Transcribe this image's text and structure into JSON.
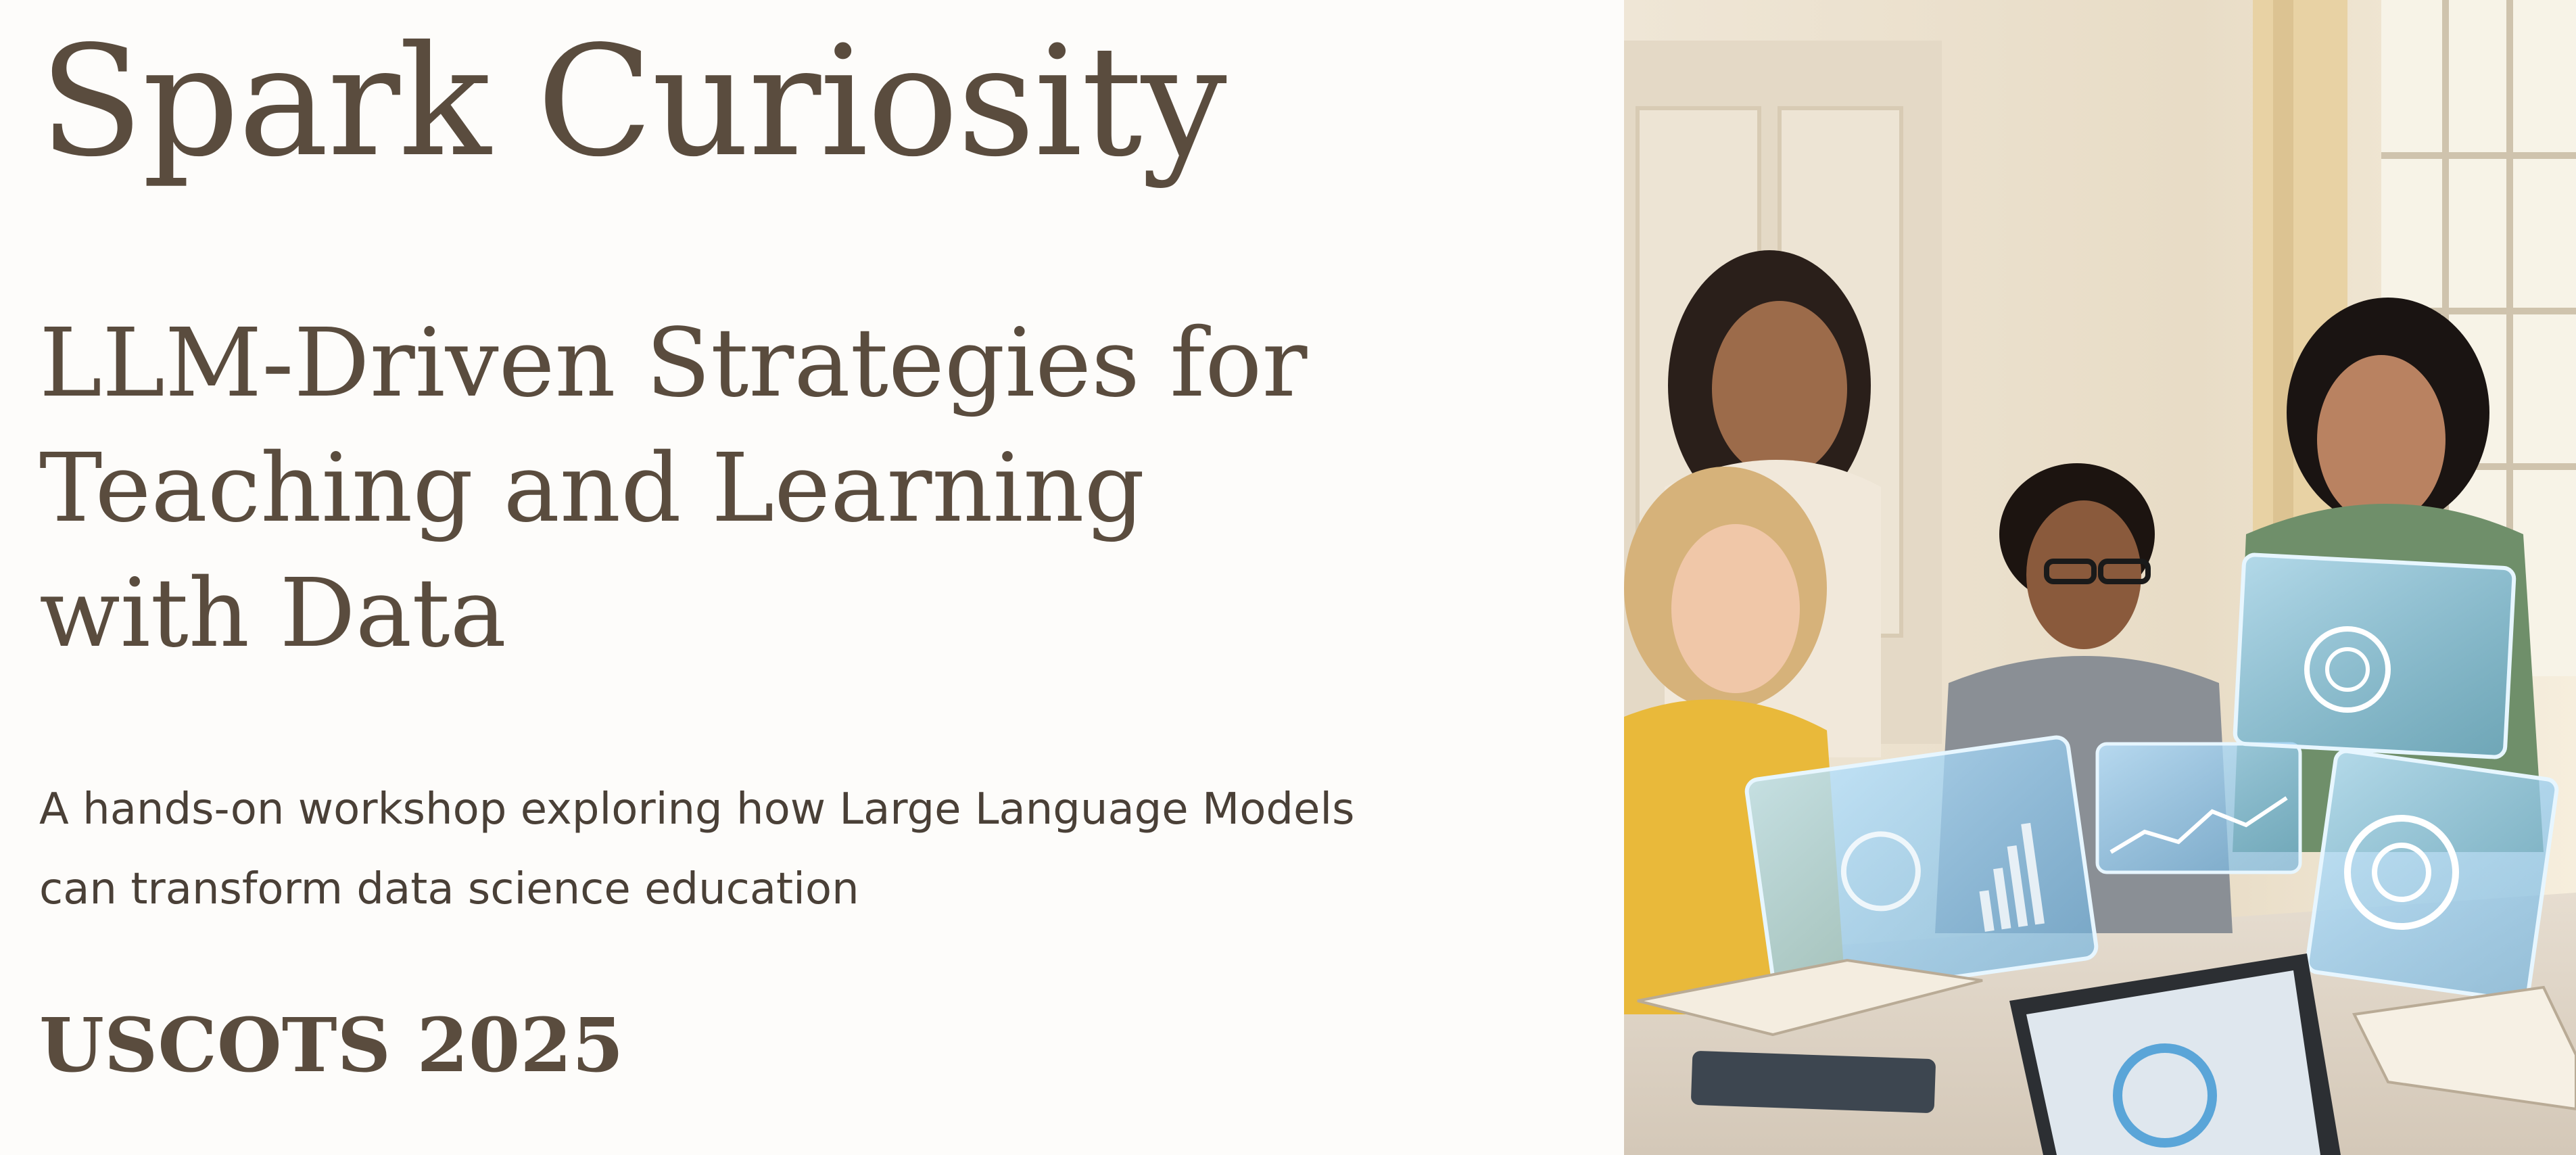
{
  "hero": {
    "title": "Spark Curiosity",
    "subtitle_lines": [
      "LLM-Driven Strategies for",
      "Teaching and Learning",
      "with Data"
    ],
    "description_lines": [
      "A hands-on workshop exploring how Large Language Models",
      "can transform data science education"
    ],
    "event": "USCOTS 2025"
  },
  "photo": {
    "icon": "classroom-photo-icon"
  },
  "colors": {
    "heading": "#5a4c3e",
    "body_text": "#4a4037",
    "background": "#fdfcfa",
    "hologram": "#9fd4f5"
  }
}
